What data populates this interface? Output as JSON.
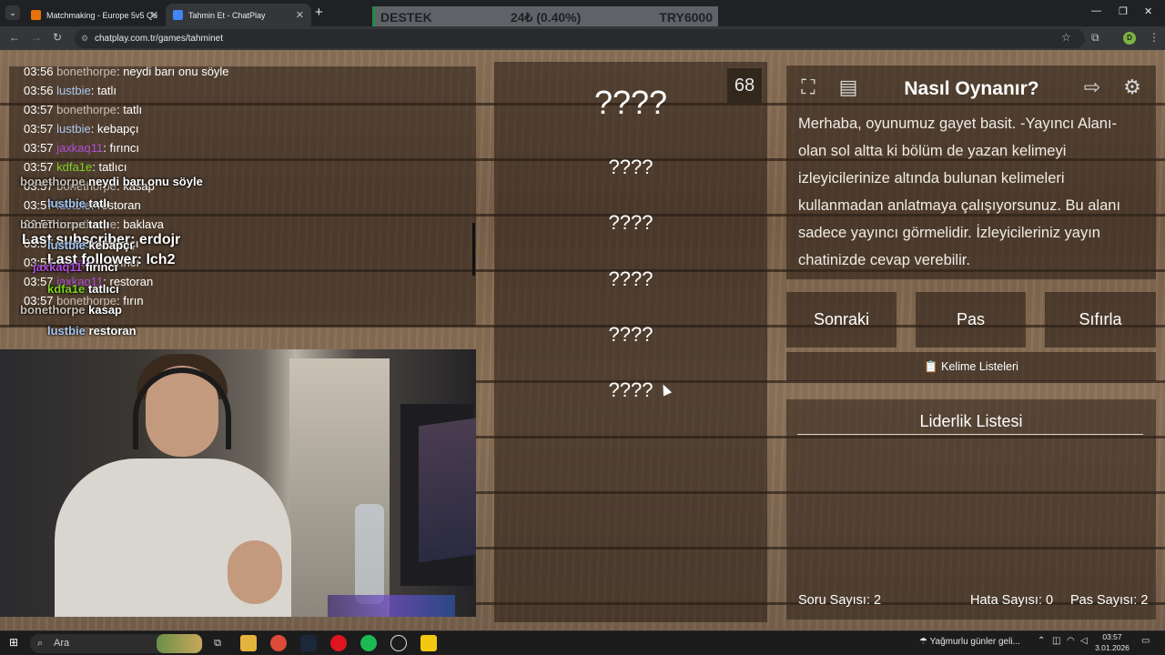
{
  "browser": {
    "tabs": [
      {
        "label": "Matchmaking - Europe 5v5 Qu",
        "favicon_color": "#e8710a"
      },
      {
        "label": "Tahmin Et - ChatPlay",
        "favicon_color": "#4285f4",
        "active": true
      }
    ],
    "new_tab": "+",
    "url": "chatplay.com.tr/games/tahminet",
    "profile_initial": "D"
  },
  "ticker": {
    "left": "DESTEK",
    "middle": "24₺ (0.40%)",
    "right": "TRY6000"
  },
  "chat": {
    "messages": [
      {
        "time": "03:56",
        "user": "bonethorpe",
        "color": "#c8bfb5",
        "text": "neydi barı onu söyle"
      },
      {
        "time": "03:56",
        "user": "lustbie",
        "color": "#a9c8f0",
        "text": "tatlı"
      },
      {
        "time": "03:57",
        "user": "bonethorpe",
        "color": "#c8bfb5",
        "text": "tatlı"
      },
      {
        "time": "03:57",
        "user": "lustbie",
        "color": "#a9c8f0",
        "text": "kebapçı"
      },
      {
        "time": "03:57",
        "user": "jaxkaq11",
        "color": "#b04fd8",
        "text": "fırıncı"
      },
      {
        "time": "03:57",
        "user": "kdfa1e",
        "color": "#7ed321",
        "text": "tatlıcı"
      },
      {
        "time": "03:57",
        "user": "bonethorpe",
        "color": "#c8bfb5",
        "text": "kasap"
      },
      {
        "time": "03:57",
        "user": "lustbie",
        "color": "#a9c8f0",
        "text": "restoran"
      },
      {
        "time": "03:57",
        "user": "bonethorpe",
        "color": "#c8bfb5",
        "text": "baklava"
      },
      {
        "time": "03:57",
        "user": "lustbie",
        "color": "#a9c8f0",
        "text": "kebapçı"
      },
      {
        "time": "03:57",
        "user": "jaxkaq11",
        "color": "#b04fd8",
        "text": "fırıncı"
      },
      {
        "time": "03:57",
        "user": "jaxkaq11",
        "color": "#b04fd8",
        "text": "restoran"
      },
      {
        "time": "03:57",
        "user": "bonethorpe",
        "color": "#c8bfb5",
        "text": "fırın"
      }
    ]
  },
  "overlay": {
    "lines": [
      {
        "user": "bonethorpe",
        "text": "neydi barı onu söyle",
        "color": "#c8bfb5"
      },
      {
        "user": "lustbie",
        "text": "tatlı",
        "color": "#a9c8f0"
      },
      {
        "user": "bonethorpe",
        "text": "tatlı",
        "color": "#c8bfb5"
      },
      {
        "user": "lustbie",
        "text": "kebapçı",
        "color": "#a9c8f0"
      },
      {
        "user": "jaxkaq11",
        "text": "fırıncı",
        "color": "#b04fd8"
      },
      {
        "user": "kdfa1e",
        "text": "tatlıcı",
        "color": "#7ed321"
      },
      {
        "user": "bonethorpe",
        "text": "kasap",
        "color": "#c8bfb5"
      },
      {
        "user": "lustbie",
        "text": "restoran",
        "color": "#a9c8f0"
      }
    ],
    "last_subscriber": "Last subscriber: erdojr",
    "last_follower": "Last follower: lch2"
  },
  "game": {
    "counter": "68",
    "main_word": "????",
    "words": [
      "????",
      "????",
      "????",
      "????",
      "????"
    ]
  },
  "howto": {
    "title": "Nasıl Oynanır?",
    "text": "Merhaba, oyunumuz gayet basit. -Yayıncı Alanı- olan sol altta ki bölüm de yazan kelimeyi izleyicilerinize altında bulunan kelimeleri kullanmadan anlatmaya çalışıyorsunuz. Bu alanı sadece yayıncı görmelidir. İzleyicileriniz yayın chatinizde cevap verebilir."
  },
  "actions": {
    "next": "Sonraki",
    "pass": "Pas",
    "reset": "Sıfırla",
    "word_lists": "Kelime Listeleri"
  },
  "leaderboard": {
    "title": "Liderlik Listesi",
    "question_count_label": "Soru Sayısı: 2",
    "error_count_label": "Hata Sayısı: 0",
    "pass_count_label": "Pas Sayısı: 2"
  },
  "taskbar": {
    "search_placeholder": "Ara",
    "weather": "Yağmurlu günler geli...",
    "time": "03:57",
    "date": "3.01.2026"
  }
}
